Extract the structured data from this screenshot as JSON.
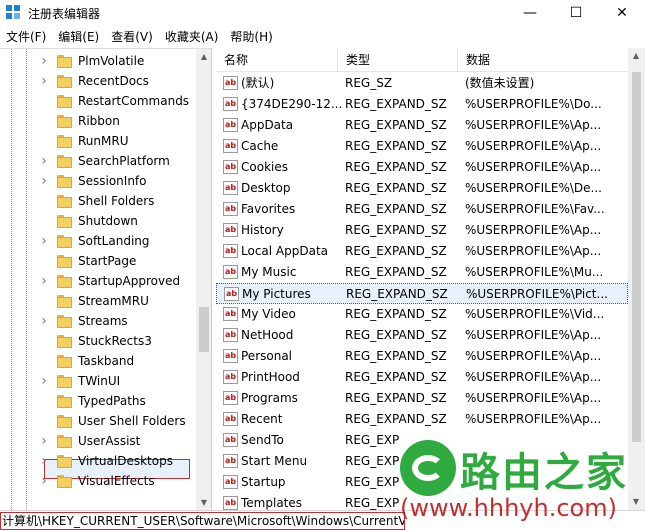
{
  "window": {
    "title": "注册表编辑器",
    "minimize_glyph": "—",
    "maximize_glyph": "☐",
    "close_glyph": "✕"
  },
  "menu": {
    "items": [
      "文件(F)",
      "编辑(E)",
      "查看(V)",
      "收藏夹(A)",
      "帮助(H)"
    ]
  },
  "tree": {
    "items": [
      {
        "label": "PlmVolatile",
        "expandable": true
      },
      {
        "label": "RecentDocs",
        "expandable": true
      },
      {
        "label": "RestartCommands",
        "expandable": false
      },
      {
        "label": "Ribbon",
        "expandable": false
      },
      {
        "label": "RunMRU",
        "expandable": false
      },
      {
        "label": "SearchPlatform",
        "expandable": true
      },
      {
        "label": "SessionInfo",
        "expandable": true
      },
      {
        "label": "Shell Folders",
        "expandable": false
      },
      {
        "label": "Shutdown",
        "expandable": false
      },
      {
        "label": "SoftLanding",
        "expandable": true
      },
      {
        "label": "StartPage",
        "expandable": false
      },
      {
        "label": "StartupApproved",
        "expandable": true
      },
      {
        "label": "StreamMRU",
        "expandable": false
      },
      {
        "label": "Streams",
        "expandable": true
      },
      {
        "label": "StuckRects3",
        "expandable": false
      },
      {
        "label": "Taskband",
        "expandable": false
      },
      {
        "label": "TWinUI",
        "expandable": true
      },
      {
        "label": "TypedPaths",
        "expandable": false
      },
      {
        "label": "User Shell Folders",
        "expandable": false,
        "selected": true
      },
      {
        "label": "UserAssist",
        "expandable": true
      },
      {
        "label": "VirtualDesktops",
        "expandable": true
      },
      {
        "label": "VisualEffects",
        "expandable": true
      }
    ]
  },
  "list": {
    "headers": [
      "名称",
      "类型",
      "数据"
    ],
    "rows": [
      {
        "name": "(默认)",
        "type": "REG_SZ",
        "data": "(数值未设置)"
      },
      {
        "name": "{374DE290-12...",
        "type": "REG_EXPAND_SZ",
        "data": "%USERPROFILE%\\Do..."
      },
      {
        "name": "AppData",
        "type": "REG_EXPAND_SZ",
        "data": "%USERPROFILE%\\Ap..."
      },
      {
        "name": "Cache",
        "type": "REG_EXPAND_SZ",
        "data": "%USERPROFILE%\\Ap..."
      },
      {
        "name": "Cookies",
        "type": "REG_EXPAND_SZ",
        "data": "%USERPROFILE%\\Ap..."
      },
      {
        "name": "Desktop",
        "type": "REG_EXPAND_SZ",
        "data": "%USERPROFILE%\\De..."
      },
      {
        "name": "Favorites",
        "type": "REG_EXPAND_SZ",
        "data": "%USERPROFILE%\\Fav..."
      },
      {
        "name": "History",
        "type": "REG_EXPAND_SZ",
        "data": "%USERPROFILE%\\Ap..."
      },
      {
        "name": "Local AppData",
        "type": "REG_EXPAND_SZ",
        "data": "%USERPROFILE%\\Ap..."
      },
      {
        "name": "My Music",
        "type": "REG_EXPAND_SZ",
        "data": "%USERPROFILE%\\Mu..."
      },
      {
        "name": "My Pictures",
        "type": "REG_EXPAND_SZ",
        "data": "%USERPROFILE%\\Pict...",
        "selected": true
      },
      {
        "name": "My Video",
        "type": "REG_EXPAND_SZ",
        "data": "%USERPROFILE%\\Vid..."
      },
      {
        "name": "NetHood",
        "type": "REG_EXPAND_SZ",
        "data": "%USERPROFILE%\\Ap..."
      },
      {
        "name": "Personal",
        "type": "REG_EXPAND_SZ",
        "data": "%USERPROFILE%\\Ap..."
      },
      {
        "name": "PrintHood",
        "type": "REG_EXPAND_SZ",
        "data": "%USERPROFILE%\\Ap..."
      },
      {
        "name": "Programs",
        "type": "REG_EXPAND_SZ",
        "data": "%USERPROFILE%\\Ap..."
      },
      {
        "name": "Recent",
        "type": "REG_EXPAND_SZ",
        "data": "%USERPROFILE%\\Ap..."
      },
      {
        "name": "SendTo",
        "type": "REG_EXP",
        "data": ""
      },
      {
        "name": "Start Menu",
        "type": "REG_EXP",
        "data": ""
      },
      {
        "name": "Startup",
        "type": "REG_EXP",
        "data": ""
      },
      {
        "name": "Templates",
        "type": "REG_EXP",
        "data": ""
      }
    ],
    "value_icon_text": "ab"
  },
  "statusbar": {
    "path": "计算机\\HKEY_CURRENT_USER\\Software\\Microsoft\\Windows\\CurrentVersion\\Explorer\\User Shell Folders"
  },
  "watermark": {
    "brand": "路由之家",
    "url": "(www.hhhyh.com)"
  },
  "colors": {
    "accent": "#1e7fd6",
    "highlight_border": "#c03030",
    "folder": "#f4cf5d",
    "watermark_green": "#2eaa3f",
    "watermark_red": "#c01818"
  }
}
